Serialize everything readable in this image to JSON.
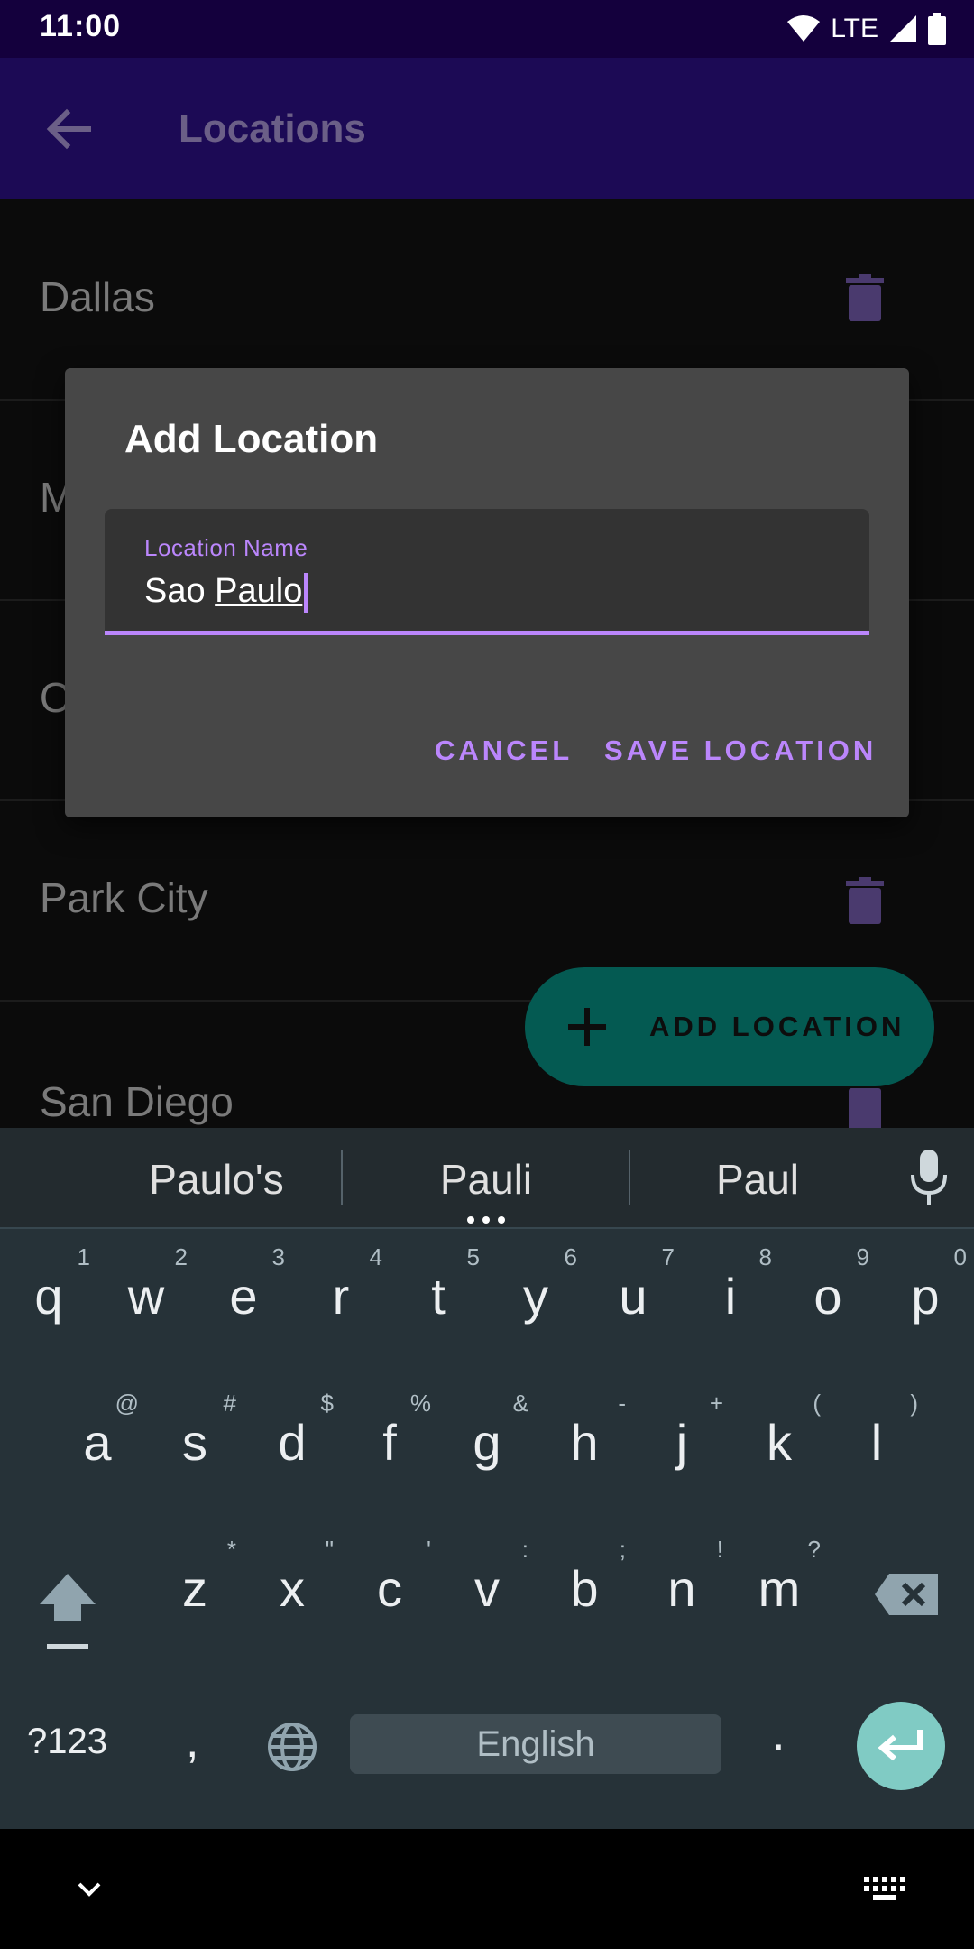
{
  "status_bar": {
    "time": "11:00",
    "network": "LTE"
  },
  "app_bar": {
    "title": "Locations",
    "back_icon": "back-arrow-icon"
  },
  "locations": [
    {
      "name": "Dallas"
    },
    {
      "name": "M"
    },
    {
      "name": "O"
    },
    {
      "name": "Park City"
    },
    {
      "name": "San Diego"
    }
  ],
  "fab": {
    "label": "ADD LOCATION",
    "icon": "plus-icon"
  },
  "dialog": {
    "title": "Add Location",
    "field_label": "Location Name",
    "field_value_plain": "Sao ",
    "field_value_underlined": "Paulo",
    "cancel_label": "CANCEL",
    "save_label": "SAVE LOCATION"
  },
  "keyboard": {
    "suggestions": [
      "Paulo's",
      "Pauli",
      "Paul"
    ],
    "row1": [
      [
        "q",
        "1"
      ],
      [
        "w",
        "2"
      ],
      [
        "e",
        "3"
      ],
      [
        "r",
        "4"
      ],
      [
        "t",
        "5"
      ],
      [
        "y",
        "6"
      ],
      [
        "u",
        "7"
      ],
      [
        "i",
        "8"
      ],
      [
        "o",
        "9"
      ],
      [
        "p",
        "0"
      ]
    ],
    "row2": [
      [
        "a",
        "@"
      ],
      [
        "s",
        "#"
      ],
      [
        "d",
        "$"
      ],
      [
        "f",
        "%"
      ],
      [
        "g",
        "&"
      ],
      [
        "h",
        "-"
      ],
      [
        "j",
        "+"
      ],
      [
        "k",
        "("
      ],
      [
        "l",
        ")"
      ]
    ],
    "row3": [
      [
        "z",
        "*"
      ],
      [
        "x",
        "\""
      ],
      [
        "c",
        "'"
      ],
      [
        "v",
        ":"
      ],
      [
        "b",
        ";"
      ],
      [
        "n",
        "!"
      ],
      [
        "m",
        "?"
      ]
    ],
    "symbols_label": "?123",
    "comma": ",",
    "space_label": "English",
    "period": "."
  },
  "colors": {
    "accent": "#bb86fc",
    "fab": "#045a52",
    "app_bar": "#1c0a55",
    "status_bar": "#14003d",
    "enter_key": "#80cbc4"
  }
}
